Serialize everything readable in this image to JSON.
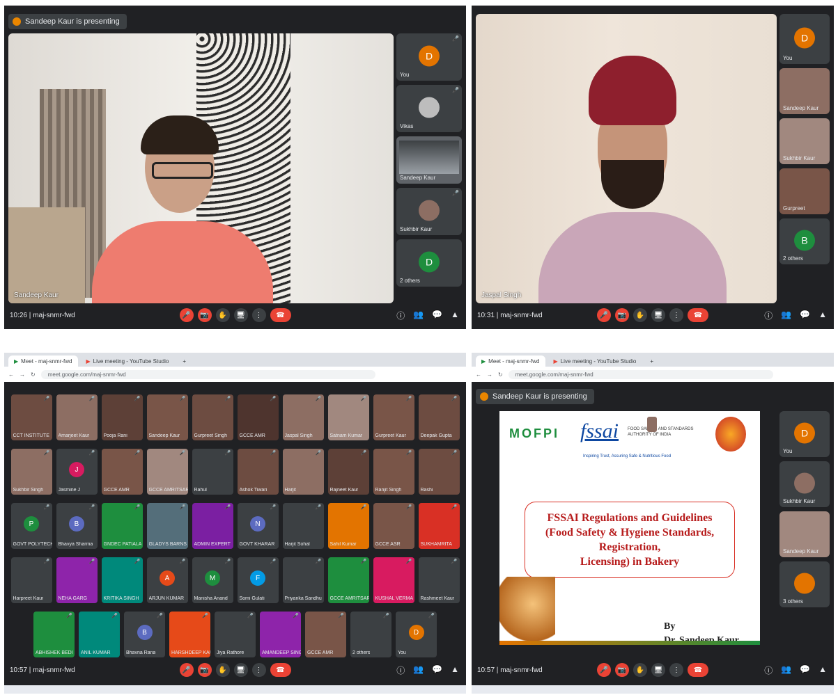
{
  "q1": {
    "banner": "Sandeep Kaur is presenting",
    "main_name": "Sandeep Kaur",
    "time": "10:26",
    "meeting_code": "maj-snmr-fwd",
    "side": [
      {
        "name": "You",
        "initial": "D",
        "color": "#e37400"
      },
      {
        "name": "Vikas",
        "initial": "",
        "color": "#3c4043"
      },
      {
        "name": "Sandeep Kaur",
        "initial": "",
        "color": "#3c4043"
      },
      {
        "name": "Sukhbir Kaur",
        "initial": "",
        "color": "#3c4043"
      },
      {
        "name": "2 others",
        "initial": "D",
        "color": "#1e8e3e"
      }
    ]
  },
  "q2": {
    "main_name": "Jaspal Singh",
    "time": "10:31",
    "meeting_code": "maj-snmr-fwd",
    "side": [
      {
        "name": "You",
        "initial": "D",
        "color": "#e37400"
      },
      {
        "name": "Sandeep Kaur",
        "initial": "",
        "color": "#3c4043"
      },
      {
        "name": "Sukhbir Kaur",
        "initial": "",
        "color": "#3c4043"
      },
      {
        "name": "Gurpreet",
        "initial": "",
        "color": "#3c4043"
      },
      {
        "name": "2 others",
        "initial": "B",
        "color": "#1e8e3e"
      }
    ]
  },
  "q3": {
    "tabs": [
      "Meet - maj-snmr-fwd",
      "Live meeting - YouTube Studio"
    ],
    "url": "meet.google.com/maj-snmr-fwd",
    "time": "10:57",
    "meeting_code": "maj-snmr-fwd",
    "rows": [
      [
        {
          "name": "CCT INSTITUTE",
          "initial": "",
          "color": "#6d4c41"
        },
        {
          "name": "Amarjeet Kaur",
          "initial": "",
          "color": "#8d6e63"
        },
        {
          "name": "Pooja Rani",
          "initial": "",
          "color": "#5d4037"
        },
        {
          "name": "Sandeep Kaur",
          "initial": "",
          "color": "#795548"
        },
        {
          "name": "Gurpreet Singh",
          "initial": "",
          "color": "#6d4c41"
        },
        {
          "name": "GCCE AMR",
          "initial": "",
          "color": "#4e342e"
        },
        {
          "name": "Jaspal Singh",
          "initial": "",
          "color": "#8d6e63"
        },
        {
          "name": "Satnam Kumar",
          "initial": "",
          "color": "#a1887f"
        },
        {
          "name": "Gurpreet Kaur",
          "initial": "",
          "color": "#795548"
        },
        {
          "name": "Deepak Gupta",
          "initial": "",
          "color": "#6d4c41"
        }
      ],
      [
        {
          "name": "Sukhbir Singh",
          "initial": "",
          "color": "#8d6e63"
        },
        {
          "name": "Jasmine J",
          "initial": "J",
          "color": "#d81b60"
        },
        {
          "name": "GCCE AMR",
          "initial": "",
          "color": "#795548"
        },
        {
          "name": "GCCE AMRITSAR",
          "initial": "",
          "color": "#a1887f"
        },
        {
          "name": "Rahul",
          "initial": "",
          "color": "#3c4043"
        },
        {
          "name": "Ashok Tiwari",
          "initial": "",
          "color": "#6d4c41"
        },
        {
          "name": "Harjit",
          "initial": "",
          "color": "#8d6e63"
        },
        {
          "name": "Rajneet Kaur",
          "initial": "",
          "color": "#5d4037"
        },
        {
          "name": "Ranjit Singh",
          "initial": "",
          "color": "#795548"
        },
        {
          "name": "Rashi",
          "initial": "",
          "color": "#6d4c41"
        }
      ],
      [
        {
          "name": "GOVT POLYTECHNIC",
          "initial": "P",
          "color": "#1e8e3e"
        },
        {
          "name": "Bhavya Sharma",
          "initial": "B",
          "color": "#5c6bc0"
        },
        {
          "name": "GNDEC PATIALA",
          "initial": "",
          "color": "#1e8e3e"
        },
        {
          "name": "GLADYS BARNS",
          "initial": "",
          "color": "#546e7a"
        },
        {
          "name": "ADMIN EXPERT",
          "initial": "",
          "color": "#7b1fa2"
        },
        {
          "name": "GOVT KHARAR",
          "initial": "N",
          "color": "#5c6bc0"
        },
        {
          "name": "Harjit Sohal",
          "initial": "",
          "color": "#3c4043"
        },
        {
          "name": "Sahil Kumar",
          "initial": "",
          "color": "#e37400"
        },
        {
          "name": "GCCE ASR",
          "initial": "",
          "color": "#795548"
        },
        {
          "name": "SUKHAMRITA",
          "initial": "",
          "color": "#d93025"
        }
      ],
      [
        {
          "name": "Harpreet Kaur",
          "initial": "",
          "color": "#3c4043"
        },
        {
          "name": "NEHA GARG",
          "initial": "",
          "color": "#8e24aa"
        },
        {
          "name": "KRITIKA SINGH",
          "initial": "",
          "color": "#00897b"
        },
        {
          "name": "ARJUN KUMAR",
          "initial": "A",
          "color": "#e64a19"
        },
        {
          "name": "Manisha Anand",
          "initial": "M",
          "color": "#1e8e3e"
        },
        {
          "name": "Somi Gulati",
          "initial": "F",
          "color": "#039be5"
        },
        {
          "name": "Priyanka Sandhu",
          "initial": "",
          "color": "#3c4043"
        },
        {
          "name": "GCCE AMRITSAR",
          "initial": "",
          "color": "#1e8e3e"
        },
        {
          "name": "KUSHAL VERMA",
          "initial": "",
          "color": "#d81b60"
        },
        {
          "name": "Rashmeet Kaur",
          "initial": "",
          "color": "#3c4043"
        }
      ],
      [
        {
          "name": "ABHISHEK BEDI",
          "initial": "",
          "color": "#1e8e3e"
        },
        {
          "name": "ANIL KUMAR",
          "initial": "",
          "color": "#00897b"
        },
        {
          "name": "Bhavna Rana",
          "initial": "B",
          "color": "#5c6bc0"
        },
        {
          "name": "HARSHDEEP KAUR",
          "initial": "",
          "color": "#e64a19"
        },
        {
          "name": "Jiya Rathore",
          "initial": "",
          "color": "#3c4043"
        },
        {
          "name": "AMANDEEP SINGH",
          "initial": "",
          "color": "#8e24aa"
        },
        {
          "name": "GCCE AMR",
          "initial": "",
          "color": "#795548"
        },
        {
          "name": "2 others",
          "initial": "",
          "color": "#3c4043"
        },
        {
          "name": "You",
          "initial": "D",
          "color": "#e37400"
        }
      ]
    ]
  },
  "q4": {
    "tabs": [
      "Meet - maj-snmr-fwd",
      "Live meeting - YouTube Studio"
    ],
    "url": "meet.google.com/maj-snmr-fwd",
    "banner": "Sandeep Kaur is presenting",
    "time": "10:57",
    "meeting_code": "maj-snmr-fwd",
    "slide": {
      "logo_mofpi": "MOFPI",
      "logo_fssai": "fssai",
      "fssai_caption": "FOOD SAFETY AND STANDARDS AUTHORITY OF INDIA",
      "fssai_tagline": "Inspiring Trust, Assuring Safe & Nutritious Food",
      "title_lines": [
        "FSSAI Regulations and Guidelines",
        "(Food Safety & Hygiene Standards, Registration,",
        "Licensing) in Bakery"
      ],
      "by": "By",
      "author": "Dr. Sandeep Kaur"
    },
    "side": [
      {
        "name": "You",
        "initial": "D",
        "color": "#e37400"
      },
      {
        "name": "Sukhbir Kaur",
        "initial": "",
        "color": "#3c4043"
      },
      {
        "name": "Sandeep Kaur",
        "initial": "",
        "color": "#3c4043"
      },
      {
        "name": "3 others",
        "initial": "",
        "color": "#3c4043"
      }
    ]
  },
  "icons": {
    "mic_off": "🎤",
    "cam_off": "📷",
    "hand": "✋",
    "present": "🖥",
    "more": "⋮",
    "hangup": "☎",
    "info": "ⓘ",
    "people": "👥",
    "chat": "💬",
    "activities": "▲"
  }
}
